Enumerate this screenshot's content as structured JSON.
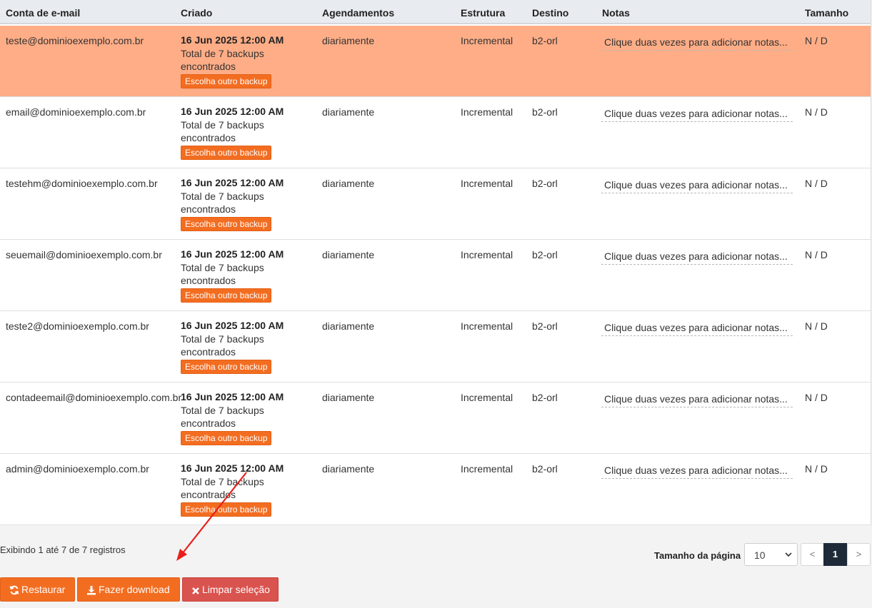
{
  "table": {
    "headers": {
      "email": "Conta de e-mail",
      "created": "Criado",
      "schedule": "Agendamentos",
      "structure": "Estrutura",
      "destination": "Destino",
      "notes": "Notas",
      "size": "Tamanho"
    },
    "rows": [
      {
        "email": "teste@dominioexemplo.com.br",
        "date": "16 Jun 2025 12:00 AM",
        "total": "Total de 7 backups encontrados",
        "choose": "Escolha outro backup",
        "schedule": "diariamente",
        "structure": "Incremental",
        "destination": "b2-orl",
        "notes": "Clique duas vezes para adicionar notas...",
        "size": "N / D",
        "selected": true
      },
      {
        "email": "email@dominioexemplo.com.br",
        "date": "16 Jun 2025 12:00 AM",
        "total": "Total de 7 backups encontrados",
        "choose": "Escolha outro backup",
        "schedule": "diariamente",
        "structure": "Incremental",
        "destination": "b2-orl",
        "notes": "Clique duas vezes para adicionar notas...",
        "size": "N / D",
        "selected": false
      },
      {
        "email": "testehm@dominioexemplo.com.br",
        "date": "16 Jun 2025 12:00 AM",
        "total": "Total de 7 backups encontrados",
        "choose": "Escolha outro backup",
        "schedule": "diariamente",
        "structure": "Incremental",
        "destination": "b2-orl",
        "notes": "Clique duas vezes para adicionar notas...",
        "size": "N / D",
        "selected": false
      },
      {
        "email": "seuemail@dominioexemplo.com.br",
        "date": "16 Jun 2025 12:00 AM",
        "total": "Total de 7 backups encontrados",
        "choose": "Escolha outro backup",
        "schedule": "diariamente",
        "structure": "Incremental",
        "destination": "b2-orl",
        "notes": "Clique duas vezes para adicionar notas...",
        "size": "N / D",
        "selected": false
      },
      {
        "email": "teste2@dominioexemplo.com.br",
        "date": "16 Jun 2025 12:00 AM",
        "total": "Total de 7 backups encontrados",
        "choose": "Escolha outro backup",
        "schedule": "diariamente",
        "structure": "Incremental",
        "destination": "b2-orl",
        "notes": "Clique duas vezes para adicionar notas...",
        "size": "N / D",
        "selected": false
      },
      {
        "email": "contadeemail@dominioexemplo.com.br",
        "date": "16 Jun 2025 12:00 AM",
        "total": "Total de 7 backups encontrados",
        "choose": "Escolha outro backup",
        "schedule": "diariamente",
        "structure": "Incremental",
        "destination": "b2-orl",
        "notes": "Clique duas vezes para adicionar notas...",
        "size": "N / D",
        "selected": false
      },
      {
        "email": "admin@dominioexemplo.com.br",
        "date": "16 Jun 2025 12:00 AM",
        "total": "Total de 7 backups encontrados",
        "choose": "Escolha outro backup",
        "schedule": "diariamente",
        "structure": "Incremental",
        "destination": "b2-orl",
        "notes": "Clique duas vezes para adicionar notas...",
        "size": "N / D",
        "selected": false
      }
    ]
  },
  "footer": {
    "info": "Exibindo 1 até 7 de 7 registros",
    "page_size_label": "Tamanho da página",
    "page_size_value": "10",
    "prev": "<",
    "current_page": "1",
    "next": ">"
  },
  "actions": {
    "restore": "Restaurar",
    "download": "Fazer download",
    "clear": "Limpar seleção"
  },
  "colors": {
    "accent": "#f36d21",
    "selected_row": "#ffad86",
    "danger": "#d9534f",
    "annotation": "#e8201c"
  },
  "icons": {
    "restore": "refresh-icon",
    "download": "download-icon",
    "clear": "close-icon"
  }
}
